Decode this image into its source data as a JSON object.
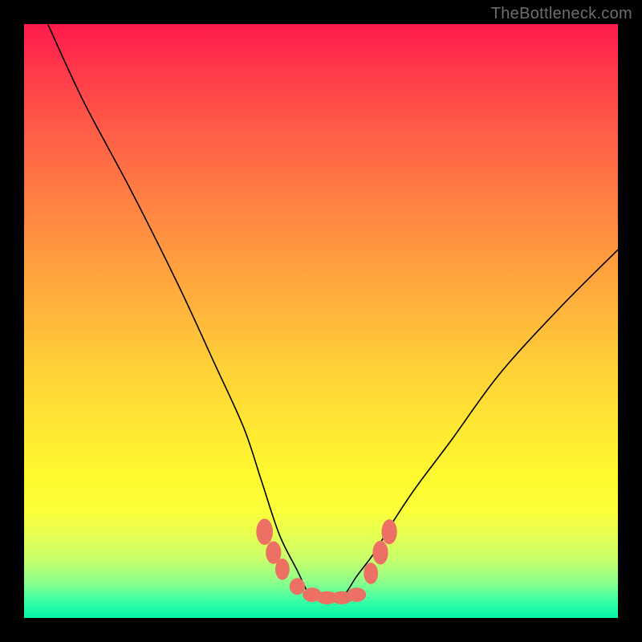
{
  "watermark": "TheBottleneck.com",
  "colors": {
    "marker_fill": "#ec7063",
    "curve_stroke": "#000000",
    "frame_bg": "#000000"
  },
  "chart_data": {
    "type": "line",
    "title": "",
    "xlabel": "",
    "ylabel": "",
    "xlim": [
      0,
      100
    ],
    "ylim": [
      0,
      100
    ],
    "grid": false,
    "series": [
      {
        "name": "bottleneck-curve",
        "x": [
          4,
          10,
          18,
          26,
          32,
          37,
          40,
          43,
          46,
          48,
          50,
          52,
          54,
          56,
          59,
          62,
          66,
          72,
          80,
          90,
          100
        ],
        "values": [
          100,
          87,
          72,
          56,
          43,
          32,
          23,
          14,
          8,
          4,
          3,
          3,
          4,
          7,
          11,
          16,
          22,
          30,
          41,
          52,
          62
        ]
      }
    ],
    "markers": [
      {
        "x": 40.5,
        "y": 14.5,
        "rx": 1.4,
        "ry": 2.2
      },
      {
        "x": 42.0,
        "y": 11.0,
        "rx": 1.3,
        "ry": 1.9
      },
      {
        "x": 43.5,
        "y": 8.2,
        "rx": 1.2,
        "ry": 1.8
      },
      {
        "x": 46.0,
        "y": 5.3,
        "rx": 1.3,
        "ry": 1.4
      },
      {
        "x": 48.5,
        "y": 3.9,
        "rx": 1.6,
        "ry": 1.2
      },
      {
        "x": 51.0,
        "y": 3.4,
        "rx": 1.8,
        "ry": 1.1
      },
      {
        "x": 53.5,
        "y": 3.4,
        "rx": 1.8,
        "ry": 1.1
      },
      {
        "x": 56.0,
        "y": 3.9,
        "rx": 1.6,
        "ry": 1.2
      },
      {
        "x": 58.4,
        "y": 7.5,
        "rx": 1.2,
        "ry": 1.8
      },
      {
        "x": 60.0,
        "y": 11.0,
        "rx": 1.3,
        "ry": 2.0
      },
      {
        "x": 61.5,
        "y": 14.5,
        "rx": 1.3,
        "ry": 2.1
      }
    ]
  }
}
